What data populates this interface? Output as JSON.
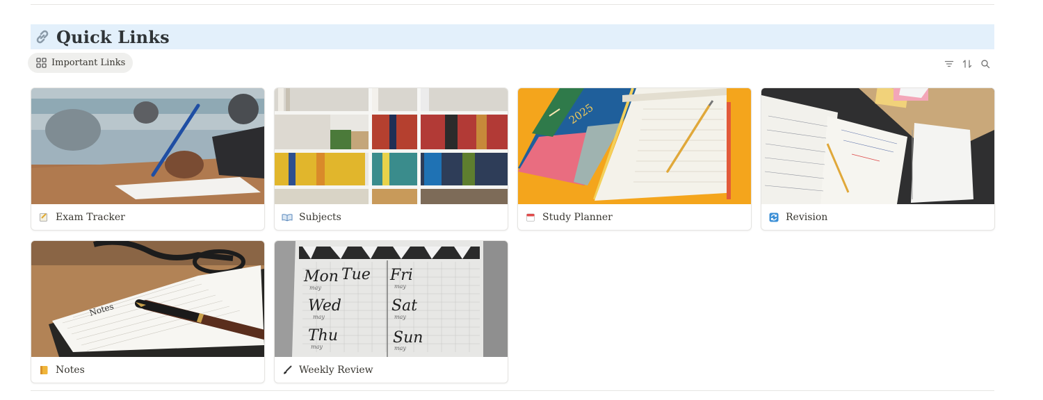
{
  "section": {
    "title": "Quick Links"
  },
  "view": {
    "tab_label": "Important Links"
  },
  "toolbar": {
    "filter_icon": "filter-icon",
    "sort_icon": "sort-icon",
    "search_icon": "search-icon"
  },
  "cards": [
    {
      "title": "Exam Tracker",
      "icon": "memo-icon"
    },
    {
      "title": "Subjects",
      "icon": "open-book-icon"
    },
    {
      "title": "Study Planner",
      "icon": "calendar-icon"
    },
    {
      "title": "Revision",
      "icon": "repeat-icon"
    },
    {
      "title": "Notes",
      "icon": "ledger-icon"
    },
    {
      "title": "Weekly Review",
      "icon": "paintbrush-icon"
    }
  ],
  "cover_text": {
    "planner_year": "2025",
    "notes_word": "Notes",
    "weekly_days": [
      "Mon",
      "Tue",
      "Fri",
      "Wed",
      "Sat",
      "Thu",
      "Sun"
    ],
    "weekly_sub": "may"
  },
  "colors": {
    "heading_bg": "#e3f0fb",
    "tab_bg": "#efefed",
    "text": "#37352f"
  }
}
